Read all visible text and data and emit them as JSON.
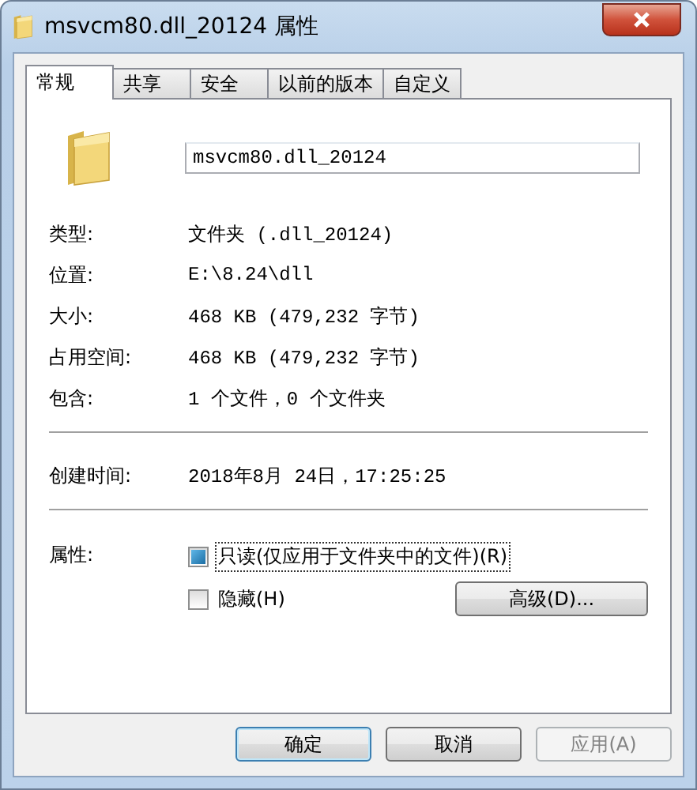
{
  "window": {
    "title": "msvcm80.dll_20124 属性"
  },
  "tabs": [
    {
      "label": "常规",
      "selected": true
    },
    {
      "label": "共享",
      "selected": false
    },
    {
      "label": "安全",
      "selected": false
    },
    {
      "label": "以前的版本",
      "selected": false
    },
    {
      "label": "自定义",
      "selected": false
    }
  ],
  "name_field": {
    "value": "msvcm80.dll_20124"
  },
  "info_groups": [
    [
      {
        "label": "类型:",
        "value": "文件夹 (.dll_20124)"
      },
      {
        "label": "位置:",
        "value": "E:\\8.24\\dll"
      },
      {
        "label": "大小:",
        "value": "468 KB (479,232 字节)"
      },
      {
        "label": "占用空间:",
        "value": "468 KB (479,232 字节)"
      },
      {
        "label": "包含:",
        "value": "1 个文件，0 个文件夹"
      }
    ],
    [
      {
        "label": "创建时间:",
        "value": "2018年8月 24日，17:25:25"
      }
    ]
  ],
  "attributes": {
    "label": "属性:",
    "checkboxes": [
      {
        "label": "只读(仅应用于文件夹中的文件)(R)",
        "checked": false,
        "indeterminate": true,
        "focused": true
      },
      {
        "label": "隐藏(H)",
        "checked": false,
        "indeterminate": false,
        "focused": false
      }
    ],
    "advanced_button": "高级(D)..."
  },
  "buttons": [
    {
      "label": "确定",
      "disabled": false,
      "default": true
    },
    {
      "label": "取消",
      "disabled": false,
      "default": false
    },
    {
      "label": "应用(A)",
      "disabled": true,
      "default": false
    }
  ]
}
